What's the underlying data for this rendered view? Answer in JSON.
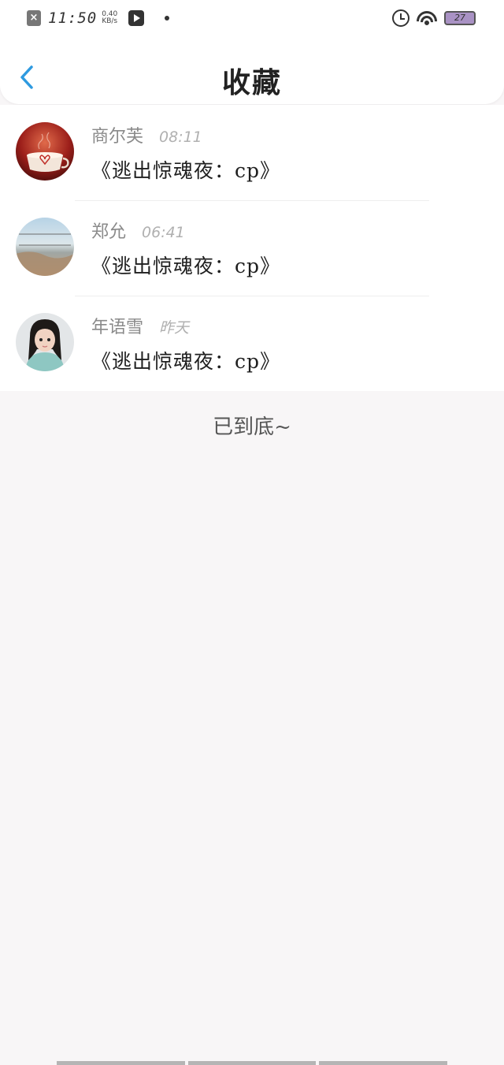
{
  "status_bar": {
    "time": "11:50",
    "speed_value": "0.40",
    "speed_unit": "KB/s",
    "battery": "27",
    "icons": [
      "close-notification-icon",
      "play-icon",
      "dot-icon",
      "alarm-icon",
      "wifi-icon",
      "battery-icon"
    ]
  },
  "header": {
    "title": "收藏",
    "back_icon": "chevron-left-icon",
    "accent_color": "#2e9ae0"
  },
  "favorites": [
    {
      "name": "商尔芙",
      "time": "08:11",
      "title": "《逃出惊魂夜：cp》"
    },
    {
      "name": "郑允",
      "time": "06:41",
      "title": "《逃出惊魂夜：cp》"
    },
    {
      "name": "年语雪",
      "time": "昨天",
      "title": "《逃出惊魂夜：cp》"
    }
  ],
  "footer": {
    "end_text": "已到底~"
  }
}
